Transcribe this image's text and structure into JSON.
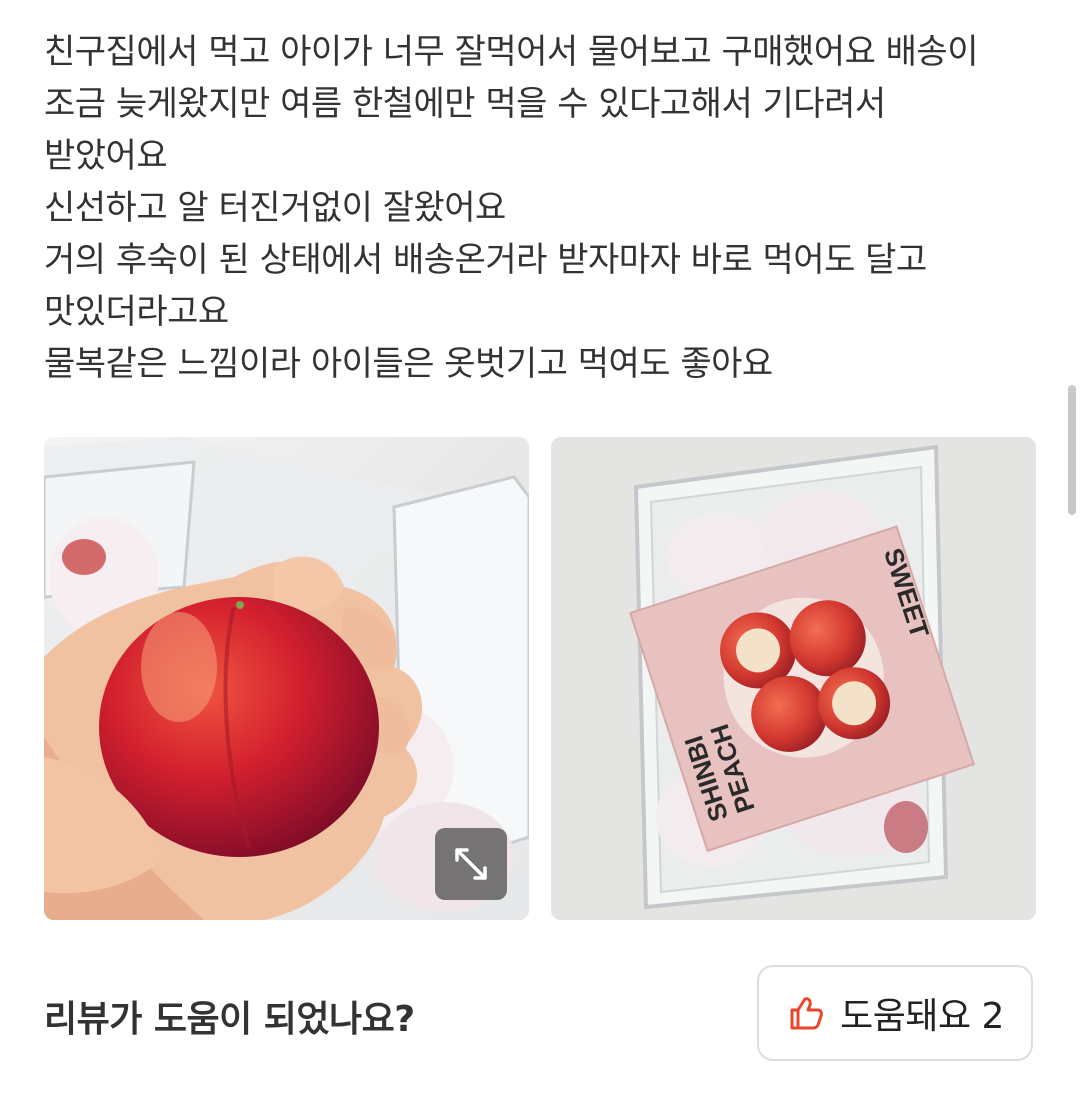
{
  "review": {
    "lines": [
      "친구집에서 먹고 아이가 너무 잘먹어서 물어보고 구매했어요 배송이",
      "조금 늦게왔지만 여름 한철에만 먹을 수 있다고해서 기다려서",
      "받았어요",
      "신선하고 알 터진거없이 잘왔어요",
      "거의 후숙이 된 상태에서 배송온거라 받자마자 바로 먹어도 달고",
      "맛있더라고요",
      "물복같은 느낌이라 아이들은 옷벗기고 먹여도 좋아요"
    ]
  },
  "photos": {
    "package_text": {
      "line1": "SHINBI",
      "line2": "PEACH",
      "side": "SWEET"
    }
  },
  "helpful": {
    "question": "리뷰가 도움이 되었나요?",
    "button_label": "도움돼요 2"
  },
  "colors": {
    "accent": "#e8452c",
    "text": "#333333",
    "border": "#dddddd"
  },
  "icons": {
    "expand": "expand-icon",
    "thumbs_up": "thumbs-up-icon"
  }
}
